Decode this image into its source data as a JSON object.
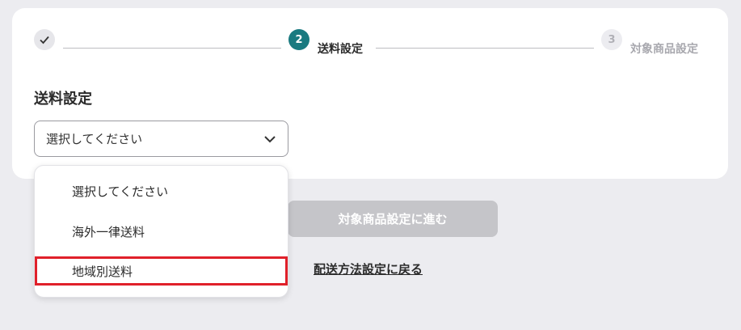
{
  "stepper": {
    "steps": [
      {
        "number": "✓",
        "label": "",
        "state": "done"
      },
      {
        "number": "2",
        "label": "送料設定",
        "state": "active"
      },
      {
        "number": "3",
        "label": "対象商品設定",
        "state": "upcoming"
      }
    ]
  },
  "form": {
    "title": "送料設定",
    "select_value": "選択してください"
  },
  "dropdown": {
    "options": [
      "選択してください",
      "海外一律送料",
      "地域別送料"
    ],
    "highlighted_index": 2
  },
  "actions": {
    "next_label": "対象商品設定に進む",
    "back_label": "配送方法設定に戻る"
  },
  "colors": {
    "active": "#1a7a80",
    "highlight": "#e0202a",
    "disabled_button": "#c5c5c9"
  }
}
